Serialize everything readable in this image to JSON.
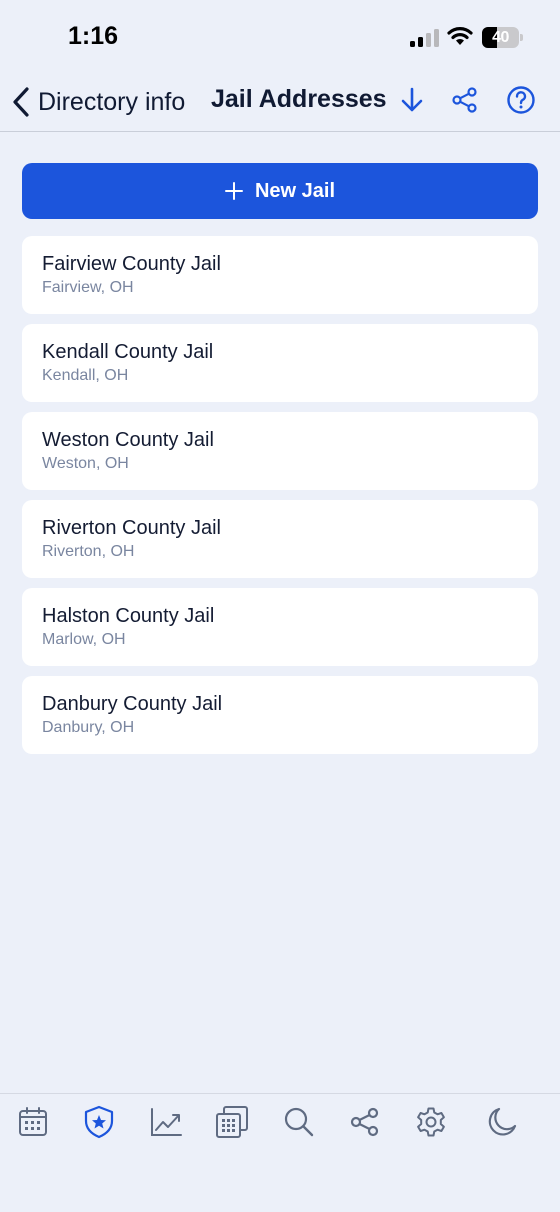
{
  "status_bar": {
    "time": "1:16",
    "battery_level": 40,
    "battery_label": "40"
  },
  "nav": {
    "back_label": "Directory info",
    "title": "Jail Addresses",
    "icons": [
      "download-icon",
      "share-icon",
      "help-icon"
    ]
  },
  "new_button": {
    "label": "New Jail",
    "icon": "plus-icon"
  },
  "jails": [
    {
      "name": "Fairview County Jail",
      "location": "Fairview, OH"
    },
    {
      "name": "Kendall County Jail",
      "location": "Kendall, OH"
    },
    {
      "name": "Weston County Jail",
      "location": "Weston, OH"
    },
    {
      "name": "Riverton County Jail",
      "location": "Riverton, OH"
    },
    {
      "name": "Halston County Jail",
      "location": "Marlow, OH"
    },
    {
      "name": "Danbury County Jail",
      "location": "Danbury, OH"
    }
  ],
  "tab_bar": {
    "tabs": [
      "calendar-icon",
      "shield-star-icon",
      "trend-chart-icon",
      "calculator-icon",
      "search-icon",
      "share-icon",
      "settings-gear-icon",
      "moon-icon"
    ],
    "active": "shield-star-icon"
  },
  "colors": {
    "accent": "#1c55dc",
    "background": "#ecf0f9",
    "icon_gray": "#5f6b82"
  }
}
